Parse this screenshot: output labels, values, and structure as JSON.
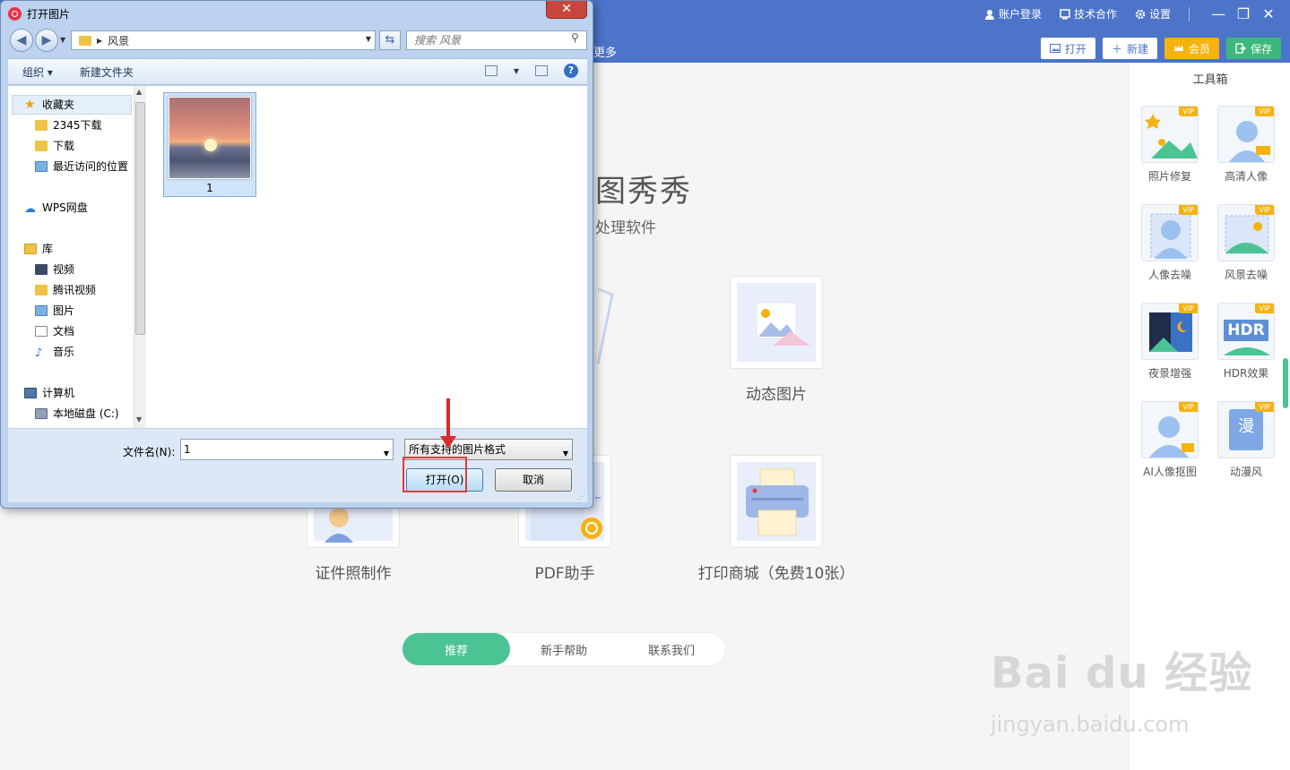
{
  "app": {
    "top_links": [
      {
        "label": "账户登录",
        "icon": "user-icon"
      },
      {
        "label": "技术合作",
        "icon": "monitor-icon"
      },
      {
        "label": "设置",
        "icon": "gear-icon"
      }
    ],
    "window_controls": {
      "minimize": "—",
      "maximize": "❐",
      "close": "✕"
    },
    "nav_more": "更多",
    "actions": {
      "open": "打开",
      "new": "新建",
      "vip": "会员",
      "save": "保存"
    },
    "brand_title": "图秀秀",
    "brand_sub": "处理软件",
    "cards": {
      "dynamic": "动态图片",
      "idphoto": "证件照制作",
      "pdf": "PDF助手",
      "print": "打印商城（免费10张）"
    },
    "bottom_tabs": [
      "推荐",
      "新手帮助",
      "联系我们"
    ],
    "toolbox": {
      "title": "工具箱",
      "vip_label": "VIP",
      "tools": [
        "照片修复",
        "高清人像",
        "人像去噪",
        "风景去噪",
        "夜景增强",
        "HDR效果",
        "AI人像抠图",
        "动漫风"
      ],
      "hdr_text": "HDR",
      "anime_char": "漫"
    },
    "watermark": {
      "main": "Bai du 经验",
      "sub": "jingyan.baidu.com"
    },
    "colors": {
      "header": "#4c74c9",
      "accent_green": "#4cc393",
      "vip": "#f6b20f"
    }
  },
  "dialog": {
    "title": "打开图片",
    "close": "✕",
    "address": "风景",
    "search_placeholder": "搜索 风景",
    "commands": {
      "organize": "组织 ▾",
      "new_folder": "新建文件夹"
    },
    "help": "?",
    "tree": {
      "favorites": "收藏夹",
      "fav_items": [
        "2345下载",
        "下载",
        "最近访问的位置"
      ],
      "wps": "WPS网盘",
      "library": "库",
      "lib_items": [
        "视频",
        "腾讯视频",
        "图片",
        "文档",
        "音乐"
      ],
      "computer": "计算机",
      "drive": "本地磁盘 (C:)"
    },
    "files": [
      {
        "name": "1"
      }
    ],
    "filename_label": "文件名(N):",
    "filename_value": "1",
    "filetype": "所有支持的图片格式",
    "open_button": "打开(O)",
    "cancel_button": "取消"
  }
}
